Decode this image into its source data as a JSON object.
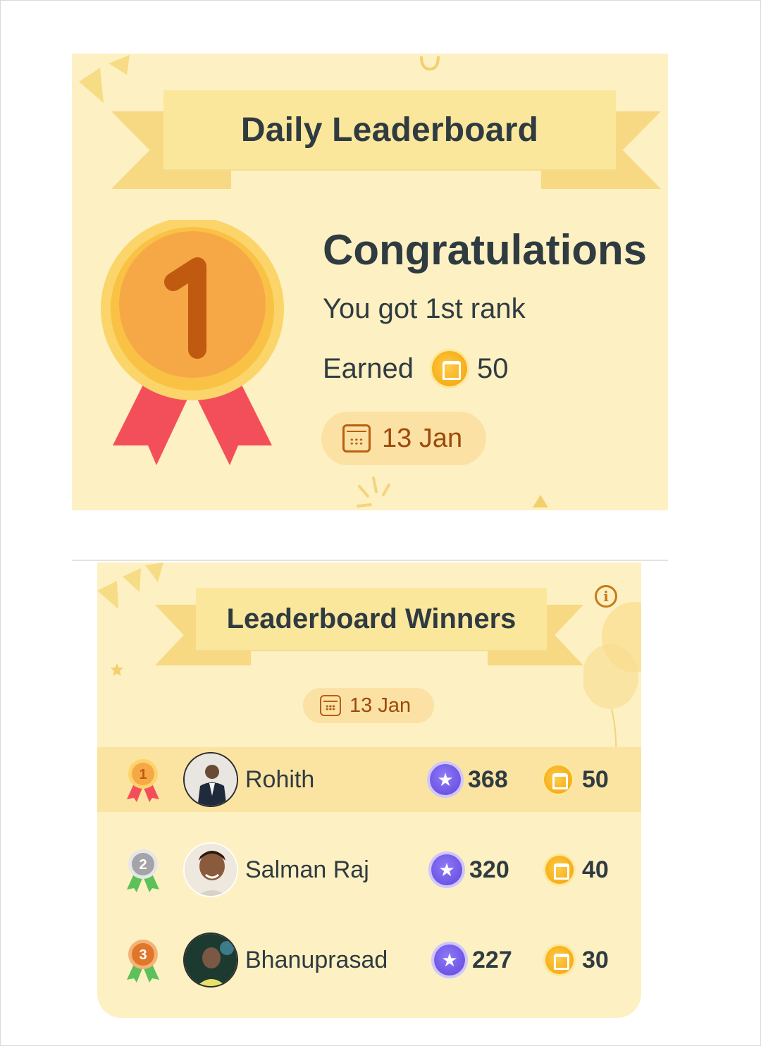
{
  "daily": {
    "title": "Daily Leaderboard",
    "rank_number": "1",
    "congrats": "Congratulations",
    "rank_text": "You got 1st rank",
    "earned_label": "Earned",
    "earned_value": "50",
    "date": "13 Jan"
  },
  "winners": {
    "title": "Leaderboard Winners",
    "date": "13 Jan",
    "info_icon": "i",
    "rows": [
      {
        "rank": "1",
        "name": "Rohith",
        "points": "368",
        "coins": "50"
      },
      {
        "rank": "2",
        "name": "Salman Raj",
        "points": "320",
        "coins": "40"
      },
      {
        "rank": "3",
        "name": "Bhanuprasad",
        "points": "227",
        "coins": "30"
      }
    ]
  },
  "colors": {
    "card_bg": "#fdf0c2",
    "ribbon": "#fbe79c",
    "gold": "#f7b21e",
    "red_ribbon": "#f34f5b",
    "purple_star": "#6e55e6",
    "date_text": "#9c4a0c"
  },
  "icons": {
    "calendar": "calendar-icon",
    "coin": "coin-icon",
    "star": "star-badge-icon",
    "info": "info-icon",
    "medal": "medal-icon"
  }
}
